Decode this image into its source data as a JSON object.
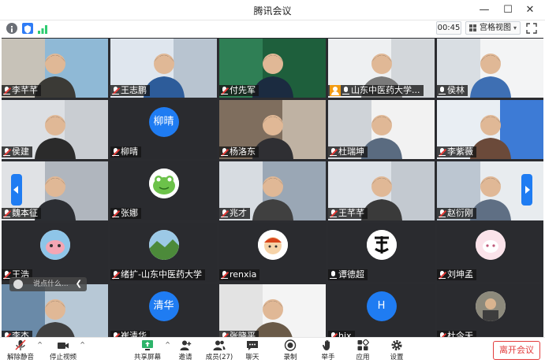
{
  "window": {
    "title": "腾讯会议",
    "minimize_icon": "minimize-icon",
    "maximize_icon": "maximize-icon",
    "close_icon": "close-icon"
  },
  "toolbar": {
    "timer": "00:45",
    "view_mode": "宫格视图",
    "view_caret": "▾"
  },
  "participants": [
    {
      "name": "李芊芊",
      "muted": true
    },
    {
      "name": "王志鹏",
      "muted": true,
      "active": true
    },
    {
      "name": "付先军",
      "muted": true
    },
    {
      "name": "山东中医药大学...",
      "muted": false,
      "host_icon": true
    },
    {
      "name": "侯林",
      "muted": false
    },
    {
      "name": "侯建",
      "muted": true
    },
    {
      "name": "柳晴",
      "muted": true,
      "avatar_text": "柳晴"
    },
    {
      "name": "杨洛东",
      "muted": true
    },
    {
      "name": "杜瑞坤",
      "muted": true
    },
    {
      "name": "李紫薇",
      "muted": true
    },
    {
      "name": "魏本征",
      "muted": true
    },
    {
      "name": "张娜",
      "muted": true
    },
    {
      "name": "兆才",
      "muted": true
    },
    {
      "name": "王芊芊",
      "muted": true
    },
    {
      "name": "赵衍刚",
      "muted": true
    },
    {
      "name": "王浩",
      "muted": true
    },
    {
      "name": "绪扩-山东中医药大学",
      "muted": true
    },
    {
      "name": "renxia",
      "muted": true
    },
    {
      "name": "谭德超",
      "muted": false
    },
    {
      "name": "刘坤孟",
      "muted": true
    },
    {
      "name": "李杰",
      "muted": true
    },
    {
      "name": "崔清华",
      "muted": true,
      "avatar_text": "清华"
    },
    {
      "name": "张晓平",
      "muted": true
    },
    {
      "name": "hjx",
      "muted": true,
      "avatar_text": "H"
    },
    {
      "name": "杜今天",
      "muted": true
    }
  ],
  "chat": {
    "placeholder": "说点什么...",
    "collapse_label": "❮"
  },
  "controls": {
    "mute": "解除静音",
    "stop_video": "停止视频",
    "share_screen": "共享屏幕",
    "invite": "邀请",
    "members": "成员(27)",
    "chat": "聊天",
    "record": "录制",
    "raise_hand": "举手",
    "apps": "应用",
    "settings": "设置",
    "leave": "离开会议"
  },
  "colors": {
    "accent": "#1f7cf2",
    "danger": "#e23c3c",
    "active_speaker": "#2ecc71",
    "tile_bg": "#2a2b2f"
  }
}
